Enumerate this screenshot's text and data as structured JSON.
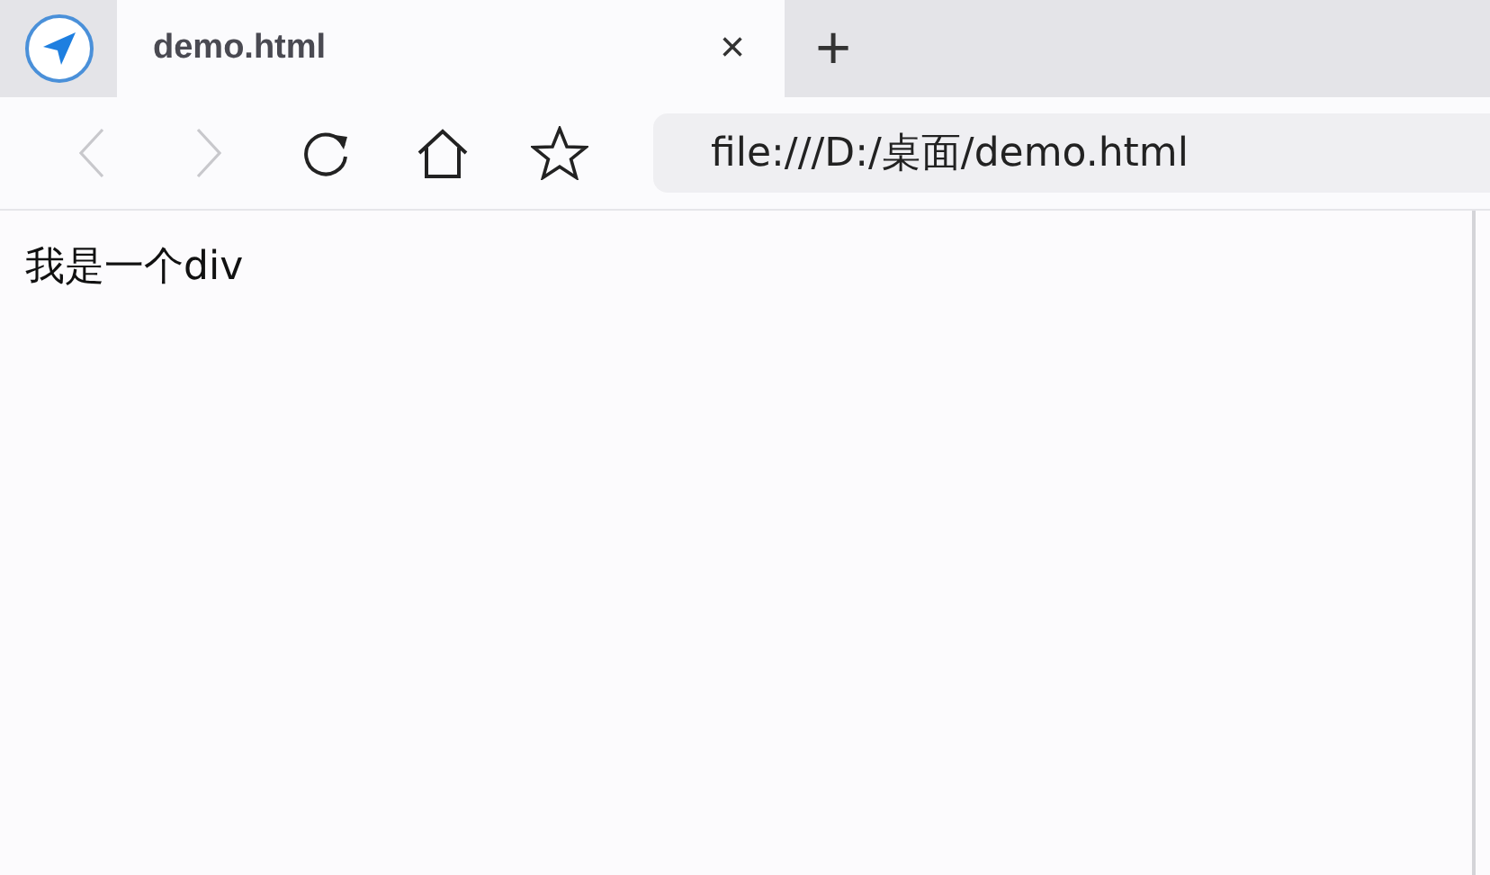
{
  "tabs": [
    {
      "title": "demo.html",
      "selected": true,
      "close": "×"
    }
  ],
  "new_tab": "+",
  "nav": {
    "back_disabled": true,
    "forward_disabled": true
  },
  "address": {
    "value": "file:///D:/桌面/demo.html"
  },
  "page": {
    "text": "我是一个div"
  }
}
